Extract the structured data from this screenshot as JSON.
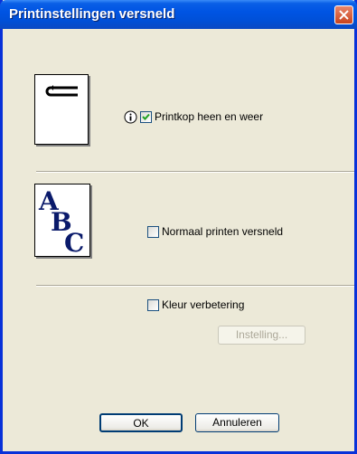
{
  "window": {
    "title": "Printinstellingen versneld"
  },
  "options": {
    "bidirectional": {
      "label": "Printkop heen en weer",
      "checked": true
    },
    "normal_fast": {
      "label": "Normaal printen versneld",
      "checked": false
    },
    "color_enhancement": {
      "label": "Kleur verbetering",
      "checked": false
    }
  },
  "buttons": {
    "settings": "Instelling...",
    "ok": "OK",
    "cancel": "Annuleren"
  },
  "icons": {
    "close": "close-icon",
    "info": "info-icon",
    "print_head": "print-head-icon",
    "abc": "abc-text-icon"
  },
  "colors": {
    "title_bar": "#0054e3",
    "close_button": "#c8431d",
    "dialog_bg": "#ece9d8",
    "icon_blue": "#0a1a6b"
  }
}
